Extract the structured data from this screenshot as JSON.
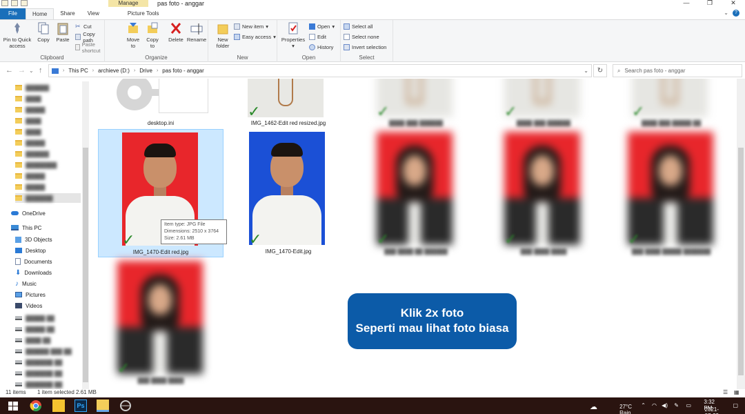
{
  "window": {
    "title": "pas foto - anggar",
    "manage_tab": "Manage",
    "controls": [
      "—",
      "❐",
      "✕"
    ]
  },
  "tabs": {
    "file": "File",
    "home": "Home",
    "share": "Share",
    "view": "View",
    "picture_tools": "Picture Tools"
  },
  "ribbon": {
    "clipboard": {
      "label": "Clipboard",
      "pin": "Pin to Quick access",
      "copy": "Copy",
      "paste": "Paste",
      "cut": "Cut",
      "copy_path": "Copy path",
      "paste_shortcut": "Paste shortcut"
    },
    "organize": {
      "label": "Organize",
      "move_to": "Move to",
      "copy_to": "Copy to",
      "delete": "Delete",
      "rename": "Rename"
    },
    "new": {
      "label": "New",
      "new_folder": "New folder",
      "new_item": "New item",
      "easy_access": "Easy access"
    },
    "open": {
      "label": "Open",
      "properties": "Properties",
      "open": "Open",
      "edit": "Edit",
      "history": "History"
    },
    "select": {
      "label": "Select",
      "select_all": "Select all",
      "select_none": "Select none",
      "invert_selection": "Invert selection"
    }
  },
  "address": {
    "crumbs": [
      "This PC",
      "archieve (D:)",
      "Drive",
      "pas foto - anggar"
    ],
    "search_placeholder": "Search pas foto - anggar"
  },
  "nav": {
    "onedrive": "OneDrive",
    "this_pc": "This PC",
    "items": [
      "3D Objects",
      "Desktop",
      "Documents",
      "Downloads",
      "Music",
      "Pictures",
      "Videos"
    ]
  },
  "files": {
    "desktop_ini": "desktop.ini",
    "img1462": "IMG_1462-Edit red resized.jpg",
    "img1470_red": "IMG_1470-Edit red.jpg",
    "img1470": "IMG_1470-Edit.jpg"
  },
  "tooltip": {
    "type": "Item type: JPG File",
    "dimensions": "Dimensions: 2510 x 3764",
    "size": "Size: 2.61 MB"
  },
  "callout": {
    "line1": "Klik 2x foto",
    "line2": "Seperti mau lihat foto biasa"
  },
  "status": {
    "count": "11 items",
    "selected": "1 item selected  2.61 MB"
  },
  "taskbar": {
    "weather": "27°C  Rain",
    "time": "3:32 PM",
    "date": "2021-07-23"
  },
  "colors": {
    "accent": "#1a6fba",
    "callout": "#0c5ba8",
    "red_bg": "#e8262b",
    "blue_bg": "#1b50d6",
    "check": "#2b8a2b"
  }
}
